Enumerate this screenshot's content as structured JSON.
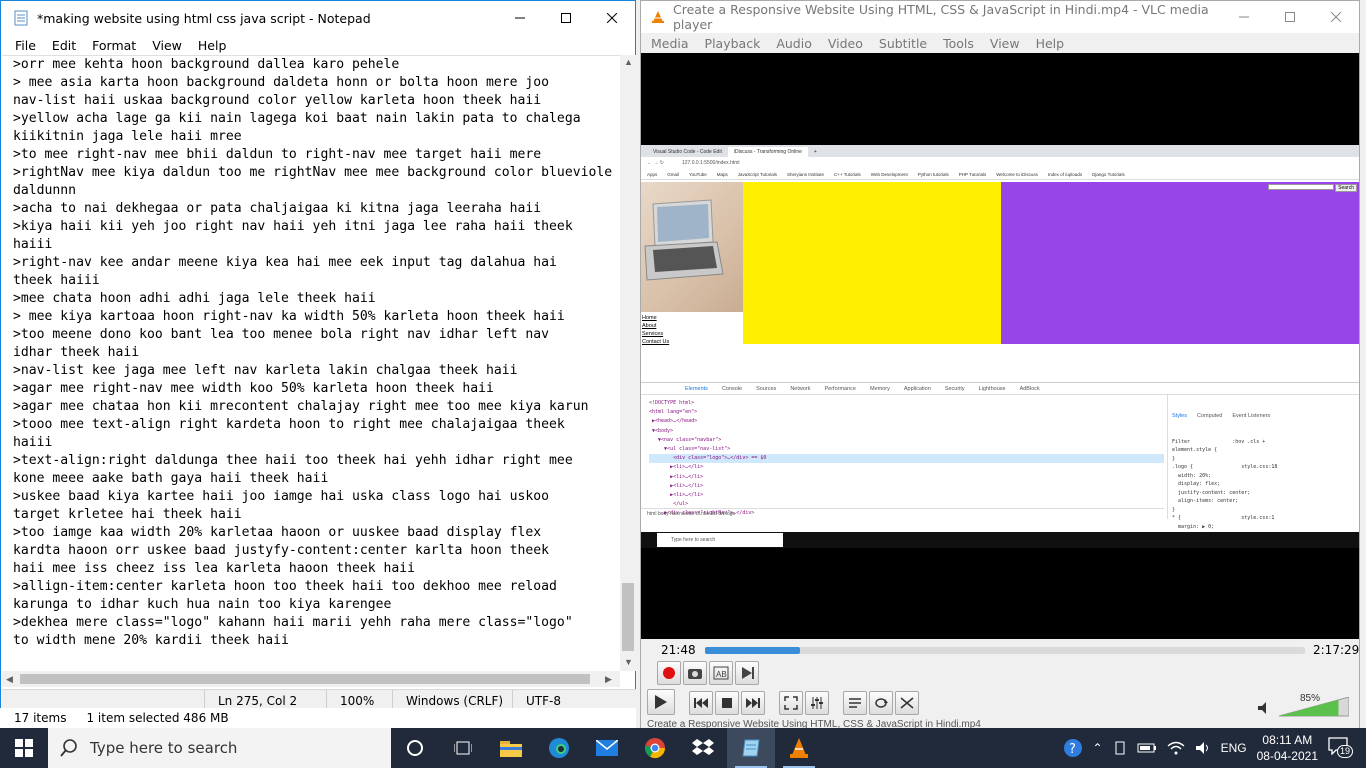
{
  "notepad": {
    "title": "*making website using html css java script - Notepad",
    "menu": [
      "File",
      "Edit",
      "Format",
      "View",
      "Help"
    ],
    "lines": [
      ">orr mee kehta hoon background dallea karo pehele",
      "> mee asia karta hoon background daldeta honn or bolta hoon mere joo",
      "nav-list haii uskaa background color yellow karleta hoon theek haii",
      ">yellow acha lage ga kii nain lagega koi baat nain lakin pata to chalega",
      "kiikitnin jaga lele haii mree",
      ">to mee right-nav mee bhii daldun to right-nav mee target haii mere",
      ">rightNav mee kiya daldun too me rightNav mee mee background color blueviole",
      "daldunnn",
      ">acha to nai dekhegaa or pata chaljaigaa ki kitna jaga leeraha haii",
      ">kiya haii kii yeh joo right nav haii yeh itni jaga lee raha haii theek",
      "haiii",
      ">right-nav kee andar meene kiya kea hai mee eek input tag dalahua hai",
      "theek haiii",
      ">mee chata hoon adhi adhi jaga lele theek haii",
      "> mee kiya kartoaa hoon right-nav ka width 50% karleta hoon theek haii",
      ">too meene dono koo bant lea too menee bola right nav idhar left nav",
      "idhar theek haii",
      ">nav-list kee jaga mee left nav karleta lakin chalgaa theek haii",
      ">agar mee right-nav mee width koo 50% karleta hoon theek haii",
      ">agar mee chataa hon kii mrecontent chalajay right mee too mee kiya karun",
      ">tooo mee text-align right kardeta hoon to right mee chalajaigaa theek",
      "haiii",
      ">text-align:right daldunga thee haii too theek hai yehh idhar right mee",
      "kone meee aake bath gaya haii theek haii",
      ">uskee baad kiya kartee haii joo iamge hai uska class logo hai uskoo",
      "target krletee hai theek haii",
      ">too iamge kaa width 20% karletaa haoon or uuskee baad display flex",
      "kardta haoon orr uskee baad justyfy-content:center karlta hoon theek",
      "haii mee iss cheez iss lea karleta haoon theek haii",
      ">allign-item:center karleta hoon too theek haii too dekhoo mee reload",
      "karunga to idhar kuch hua nain too kiya karengee",
      ">dekhea mere class=\"logo\" kahann haii marii yehh raha mere class=\"logo\"",
      "to width mene 20% kardii theek haii",
      "",
      ">"
    ],
    "status": {
      "position": "Ln 275, Col 2",
      "zoom": "100%",
      "line_ending": "Windows (CRLF)",
      "encoding": "UTF-8"
    }
  },
  "explorer": {
    "items_count": "17 items",
    "selection": "1 item selected  486 MB"
  },
  "vlc": {
    "title": "Create a Responsive Website Using HTML, CSS & JavaScript in Hindi.mp4 - VLC media player",
    "menu": [
      "Media",
      "Playback",
      "Audio",
      "Video",
      "Subtitle",
      "Tools",
      "View",
      "Help"
    ],
    "elapsed": "21:48",
    "total": "2:17:29",
    "progress_fraction": 0.1585,
    "volume": "85%",
    "volume_fraction": 0.85,
    "status_text": "Create a Responsive Website Using HTML, CSS & JavaScript in Hindi.mp4",
    "video": {
      "tabs": [
        "Visual Studio Code - Code Edit",
        "iDiscuss - Transforming Online",
        "+"
      ],
      "address": "127.0.0.1:5500/index.html",
      "bookmarks": [
        "Apps",
        "Gmail",
        "YouTube",
        "Maps",
        "JavaScript Tutorials",
        "Sheryians Institute",
        "C++ Tutorials",
        "Web Development",
        "Python tutorials",
        "PHP Tutorials",
        "Welcome to iDiscuss",
        "Index of /uploads",
        "Django Tutorials"
      ],
      "nav_links": [
        "Home",
        "About",
        "Services",
        "Contact Us"
      ],
      "search_button": "Search",
      "devtools_tabs": [
        "Elements",
        "Console",
        "Sources",
        "Network",
        "Performance",
        "Memory",
        "Application",
        "Security",
        "Lighthouse",
        "AdBlock"
      ],
      "elements_lines": [
        "<!DOCTYPE html>",
        "<html lang=\"en\">",
        " ▶<head>…</head>",
        " ▼<body>",
        "   ▼<nav class=\"navbar\">",
        "     ▼<ul class=\"nav-list\">",
        "        <div class=\"logo\">…</div> == $0",
        "       ▶<li>…</li>",
        "       ▶<li>…</li>",
        "       ▶<li>…</li>",
        "       ▶<li>…</li>",
        "        </ul>",
        "     ▶<div class=\"rightNav\">…</div>"
      ],
      "breadcrumbs": "html  body  nav.navbar  ul.nav-list  div.logo",
      "styles_tabs": [
        "Styles",
        "Computed",
        "Event Listeners"
      ],
      "styles_lines": [
        "Filter              :hov .cls +",
        "element.style {",
        "}",
        ".logo {                style.css:18",
        "  width: 20%;",
        "  display: flex;",
        "  justify-content: center;",
        "  align-items: center;",
        "}",
        "* {                    style.css:1",
        "  margin: ▶ 0;",
        "  padding: ▶ 0;"
      ],
      "taskbar_search": "Type here to search"
    }
  },
  "taskbar": {
    "search_placeholder": "Type here to search",
    "language": "ENG",
    "time": "08:11 AM",
    "date": "08-04-2021",
    "notifications": "19"
  }
}
